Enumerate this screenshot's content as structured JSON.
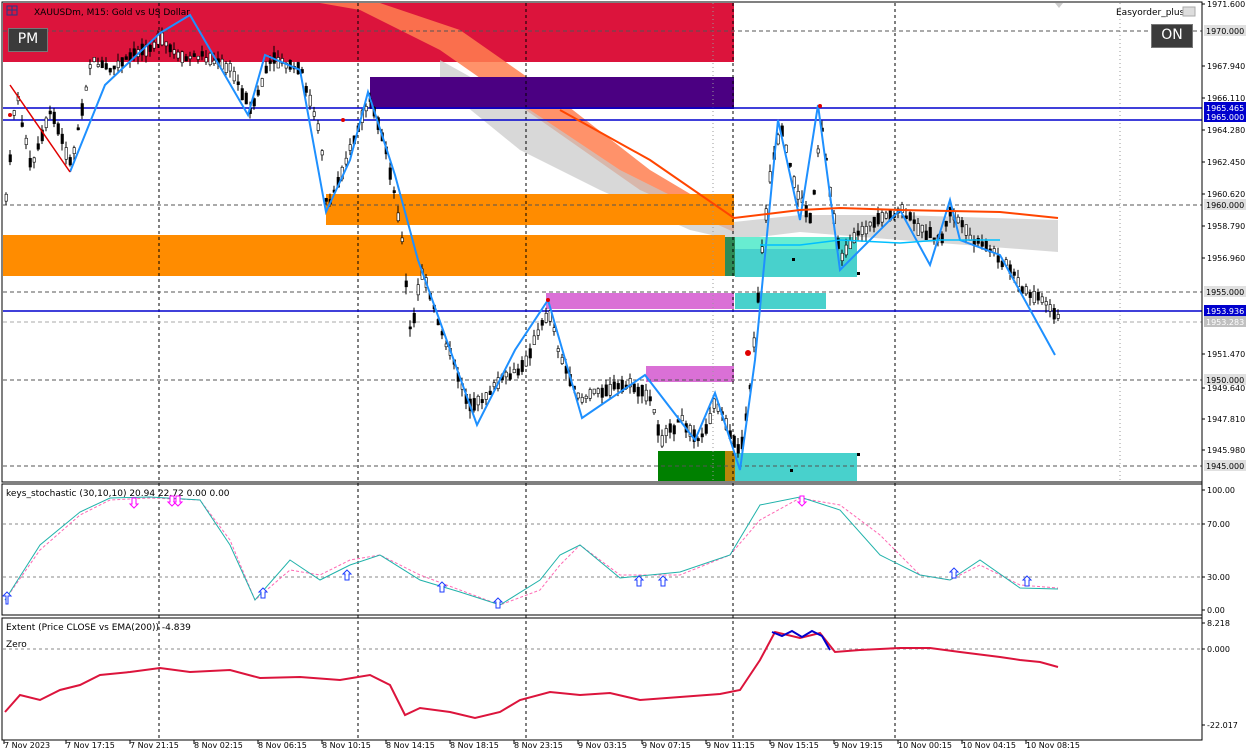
{
  "chart_header": {
    "symbol_title": "XAUUSDm, M15:  Gold vs US Dollar"
  },
  "toolbar": {
    "pm_label": "PM",
    "on_label": "ON",
    "easyorder_label": "Easyorder_plus"
  },
  "colors": {
    "bull_candle": "#000000",
    "bear_candle": "#000000",
    "zigzag_up": "#1e90ff",
    "zigzag_down": "#e00000",
    "supply_zone": "#dc143c",
    "purple_zone": "#4b0082",
    "orange_zone": "#ff8c00",
    "violet_zone": "#da70d6",
    "cyan_zone": "#48d1cc",
    "green_zone": "#008000",
    "horizontal_line": "#0000cd",
    "stoch_main": "#20b2aa",
    "stoch_signal": "#ff69b4",
    "extent_line": "#dc143c"
  },
  "price_axis": {
    "labels": [
      "1971.600",
      "1970.000",
      "1967.940",
      "1966.110",
      "1965.465",
      "1965.000",
      "1964.280",
      "1962.450",
      "1960.620",
      "1960.000",
      "1958.790",
      "1956.960",
      "1955.000",
      "1953.936",
      "1953.283",
      "1951.470",
      "1950.000",
      "1949.640",
      "1947.810",
      "1945.980",
      "1945.000"
    ]
  },
  "time_axis": {
    "labels": [
      "7 Nov 2023",
      "7 Nov 17:15",
      "7 Nov 21:15",
      "8 Nov 02:15",
      "8 Nov 06:15",
      "8 Nov 10:15",
      "8 Nov 14:15",
      "8 Nov 18:15",
      "8 Nov 23:15",
      "9 Nov 03:15",
      "9 Nov 07:15",
      "9 Nov 11:15",
      "9 Nov 15:15",
      "9 Nov 19:15",
      "10 Nov 00:15",
      "10 Nov 04:15",
      "10 Nov 08:15"
    ]
  },
  "stochastic": {
    "title": "keys_stochastic (30,10,10) 20.94 22.72 0.00 0.00",
    "axis_labels": [
      "100.00",
      "70.00",
      "30.00",
      "0.00"
    ]
  },
  "extent": {
    "title": "Extent (Price CLOSE vs EMA(200)) -4.839",
    "zero_label": "Zero",
    "axis_labels": [
      "8.218",
      "0.000",
      "-22.017"
    ]
  }
}
